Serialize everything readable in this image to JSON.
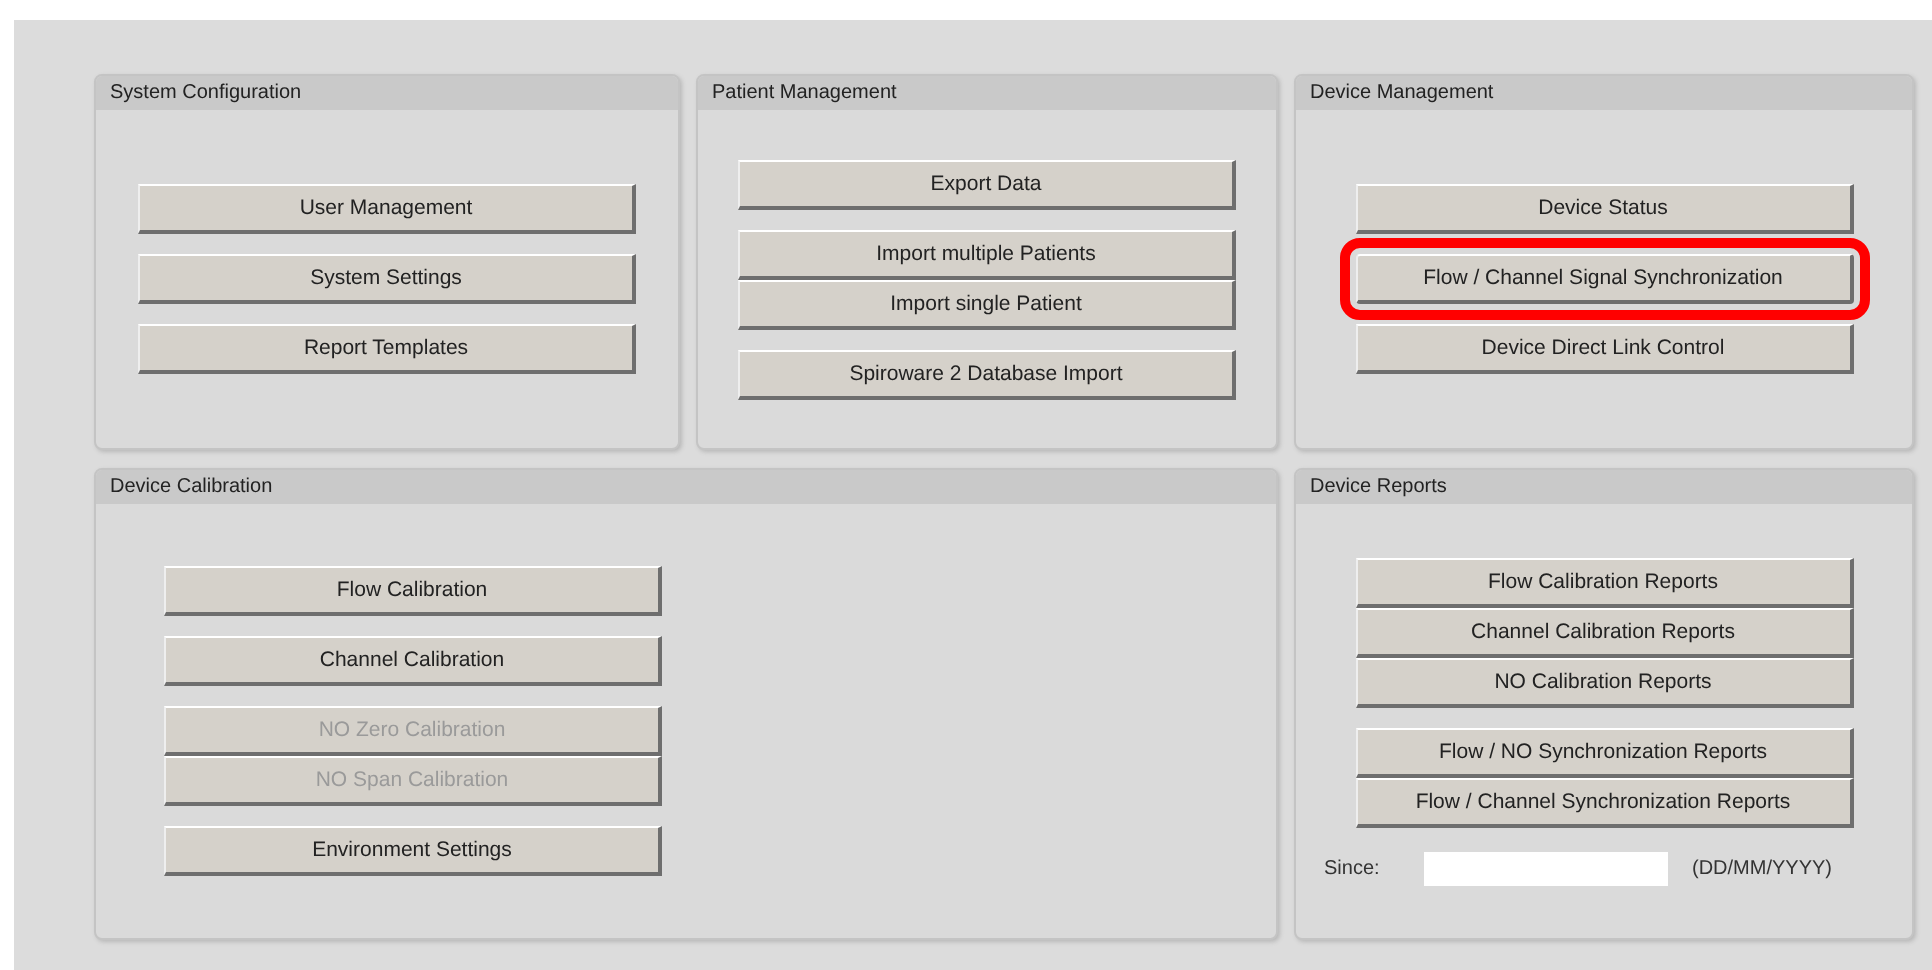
{
  "rows": [
    [
      {
        "title": "System Configuration",
        "groups": [
          [
            {
              "label": "User Management",
              "disabled": false,
              "highlighted": false
            }
          ],
          [
            {
              "label": "System Settings",
              "disabled": false,
              "highlighted": false
            }
          ],
          [
            {
              "label": "Report Templates",
              "disabled": false,
              "highlighted": false
            }
          ]
        ]
      },
      {
        "title": "Patient Management",
        "groups": [
          [
            {
              "label": "Export Data",
              "disabled": false,
              "highlighted": false
            }
          ],
          [
            {
              "label": "Import multiple Patients",
              "disabled": false,
              "highlighted": false
            },
            {
              "label": "Import single Patient",
              "disabled": false,
              "highlighted": false
            }
          ],
          [
            {
              "label": "Spiroware 2 Database Import",
              "disabled": false,
              "highlighted": false
            }
          ]
        ]
      },
      {
        "title": "Device Management",
        "groups": [
          [
            {
              "label": "Device Status",
              "disabled": false,
              "highlighted": false
            }
          ],
          [
            {
              "label": "Flow / Channel Signal Synchronization",
              "disabled": false,
              "highlighted": true
            }
          ],
          [
            {
              "label": "Device Direct Link Control",
              "disabled": false,
              "highlighted": false
            }
          ]
        ]
      }
    ],
    [
      {
        "title": "Device Calibration",
        "groups": [
          [
            {
              "label": "Flow Calibration",
              "disabled": false,
              "highlighted": false
            }
          ],
          [
            {
              "label": "Channel Calibration",
              "disabled": false,
              "highlighted": false
            }
          ],
          [
            {
              "label": "NO Zero Calibration",
              "disabled": true,
              "highlighted": false
            },
            {
              "label": "NO Span Calibration",
              "disabled": true,
              "highlighted": false
            }
          ],
          [
            {
              "label": "Environment Settings",
              "disabled": false,
              "highlighted": false
            }
          ]
        ]
      },
      {
        "title": "Device Reports",
        "groups": [
          [
            {
              "label": "Flow Calibration Reports",
              "disabled": false,
              "highlighted": false
            },
            {
              "label": "Channel Calibration Reports",
              "disabled": false,
              "highlighted": false
            },
            {
              "label": "NO Calibration Reports",
              "disabled": false,
              "highlighted": false
            }
          ],
          [
            {
              "label": "Flow / NO Synchronization Reports",
              "disabled": false,
              "highlighted": false
            },
            {
              "label": "Flow / Channel Synchronization Reports",
              "disabled": false,
              "highlighted": false
            }
          ]
        ],
        "date_field": {
          "label": "Since:",
          "format_hint": "(DD/MM/YYYY)"
        }
      }
    ]
  ]
}
